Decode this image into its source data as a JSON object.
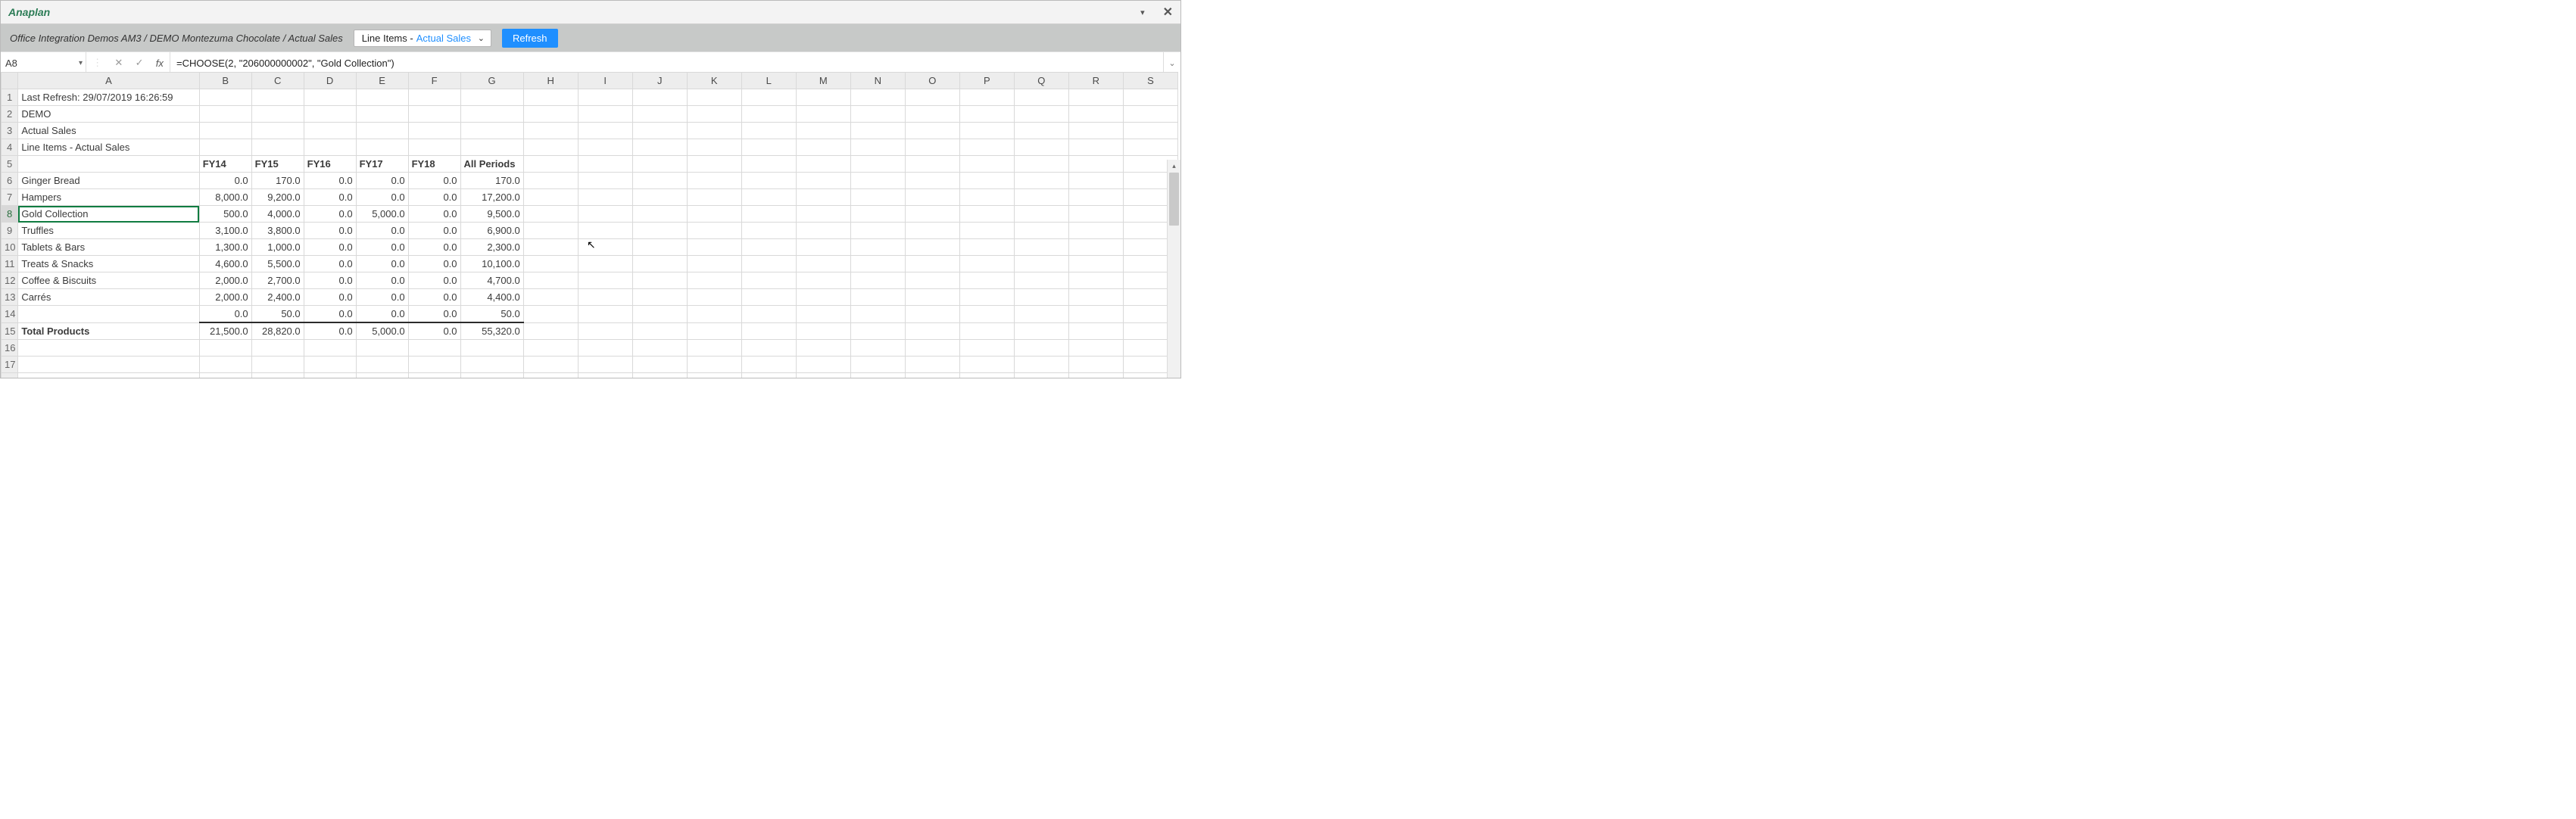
{
  "window": {
    "brand": "Anaplan",
    "minimize_icon": "▾",
    "close_icon": "✕"
  },
  "ribbon": {
    "breadcrumb": "Office Integration Demos AM3 / DEMO Montezuma Chocolate / Actual Sales",
    "selector_prefix": "Line Items - ",
    "selector_value": "Actual Sales",
    "refresh_label": "Refresh"
  },
  "formulabar": {
    "cell_ref": "A8",
    "cancel_icon": "✕",
    "confirm_icon": "✓",
    "fx_label": "fx",
    "formula": "=CHOOSE(2, \"206000000002\", \"Gold Collection\")",
    "expand_icon": "⌄"
  },
  "column_letters": [
    "A",
    "B",
    "C",
    "D",
    "E",
    "F",
    "G",
    "H",
    "I",
    "J",
    "K",
    "L",
    "M",
    "N",
    "O",
    "P",
    "Q",
    "R",
    "S"
  ],
  "info_rows": {
    "r1": "Last Refresh: 29/07/2019 16:26:59",
    "r2": "DEMO",
    "r3": "Actual Sales",
    "r4": "Line Items - Actual Sales"
  },
  "periods": [
    "FY14",
    "FY15",
    "FY16",
    "FY17",
    "FY18"
  ],
  "all_periods_label": "All Periods",
  "chart_data": {
    "type": "table",
    "title": "Line Items - Actual Sales",
    "categories": [
      "FY14",
      "FY15",
      "FY16",
      "FY17",
      "FY18",
      "All Periods"
    ],
    "series": [
      {
        "name": "Ginger Bread",
        "values": [
          "0.0",
          "170.0",
          "0.0",
          "0.0",
          "0.0",
          "170.0"
        ]
      },
      {
        "name": "Hampers",
        "values": [
          "8,000.0",
          "9,200.0",
          "0.0",
          "0.0",
          "0.0",
          "17,200.0"
        ]
      },
      {
        "name": "Gold Collection",
        "values": [
          "500.0",
          "4,000.0",
          "0.0",
          "5,000.0",
          "0.0",
          "9,500.0"
        ]
      },
      {
        "name": "Truffles",
        "values": [
          "3,100.0",
          "3,800.0",
          "0.0",
          "0.0",
          "0.0",
          "6,900.0"
        ]
      },
      {
        "name": "Tablets & Bars",
        "values": [
          "1,300.0",
          "1,000.0",
          "0.0",
          "0.0",
          "0.0",
          "2,300.0"
        ]
      },
      {
        "name": "Treats & Snacks",
        "values": [
          "4,600.0",
          "5,500.0",
          "0.0",
          "0.0",
          "0.0",
          "10,100.0"
        ]
      },
      {
        "name": "Coffee & Biscuits",
        "values": [
          "2,000.0",
          "2,700.0",
          "0.0",
          "0.0",
          "0.0",
          "4,700.0"
        ]
      },
      {
        "name": "Carrés",
        "values": [
          "2,000.0",
          "2,400.0",
          "0.0",
          "0.0",
          "0.0",
          "4,400.0"
        ]
      },
      {
        "name": "",
        "values": [
          "0.0",
          "50.0",
          "0.0",
          "0.0",
          "0.0",
          "50.0"
        ]
      }
    ],
    "total": {
      "name": "Total Products",
      "values": [
        "21,500.0",
        "28,820.0",
        "0.0",
        "5,000.0",
        "0.0",
        "55,320.0"
      ]
    }
  },
  "selected_row_index": 2
}
